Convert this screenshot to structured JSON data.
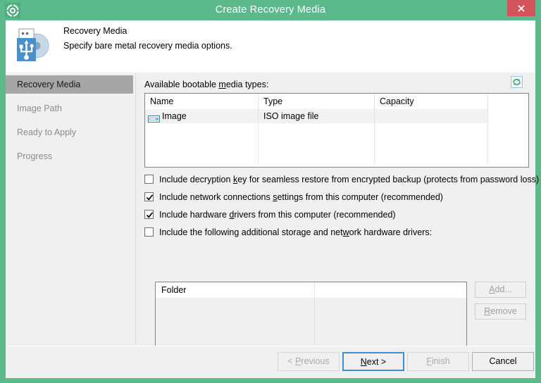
{
  "window": {
    "title": "Create Recovery Media",
    "title_icon": "lifebuoy-icon",
    "close_label": "✕",
    "accent_color": "#5cb98c",
    "close_color": "#d3545a"
  },
  "header": {
    "icon": "usb-disc-icon",
    "title": "Recovery Media",
    "subtitle": "Specify bare metal recovery media options."
  },
  "sidebar": {
    "items": [
      {
        "label": "Recovery Media",
        "selected": true
      },
      {
        "label": "Image Path",
        "selected": false
      },
      {
        "label": "Ready to Apply",
        "selected": false
      },
      {
        "label": "Progress",
        "selected": false
      }
    ]
  },
  "panel": {
    "available_label_pre": "Available bootable ",
    "available_label_key": "m",
    "available_label_post": "edia types:",
    "refresh_icon": "refresh-icon",
    "media_table": {
      "columns": [
        "Name",
        "Type",
        "Capacity",
        ""
      ],
      "rows": [
        {
          "name": "Image",
          "type": "ISO image file",
          "capacity": "",
          "extra": "",
          "icon": "disc-media-icon",
          "selected": true
        }
      ],
      "empty_row_count": 4
    },
    "checkboxes": [
      {
        "name": "include-decryption-key",
        "checked": false,
        "pre": "Include decryption ",
        "key": "k",
        "post": "ey for seamless restore from encrypted backup (protects from password loss)"
      },
      {
        "name": "include-network-settings",
        "checked": true,
        "pre": "Include network connections ",
        "key": "s",
        "post": "ettings from this computer (recommended)"
      },
      {
        "name": "include-hardware-drivers",
        "checked": true,
        "pre": "Include hardware ",
        "key": "d",
        "post": "rivers from this computer (recommended)"
      },
      {
        "name": "include-additional-drivers",
        "checked": false,
        "pre": "Include the following additional storage and net",
        "key": "w",
        "post": "ork hardware drivers:"
      }
    ],
    "folder_table": {
      "columns": [
        "Folder",
        ""
      ],
      "rows": []
    },
    "side_buttons": [
      {
        "name": "add-button",
        "pre": "A",
        "key": "",
        "post": "dd...",
        "label_key": "A",
        "label_rest": "dd...",
        "enabled": false
      },
      {
        "name": "remove-button",
        "label_key": "R",
        "label_rest": "emove",
        "enabled": false
      }
    ]
  },
  "footer": {
    "buttons": [
      {
        "name": "previous-button",
        "pre": "< ",
        "key": "P",
        "post": "revious",
        "enabled": false,
        "default": false
      },
      {
        "name": "next-button",
        "pre": "",
        "key": "N",
        "post": "ext >",
        "enabled": true,
        "default": true
      },
      {
        "name": "finish-button",
        "pre": "",
        "key": "F",
        "post": "inish",
        "enabled": false,
        "default": false
      },
      {
        "name": "cancel-button",
        "pre": "",
        "key": "",
        "post": "Cancel",
        "enabled": true,
        "default": false
      }
    ]
  }
}
